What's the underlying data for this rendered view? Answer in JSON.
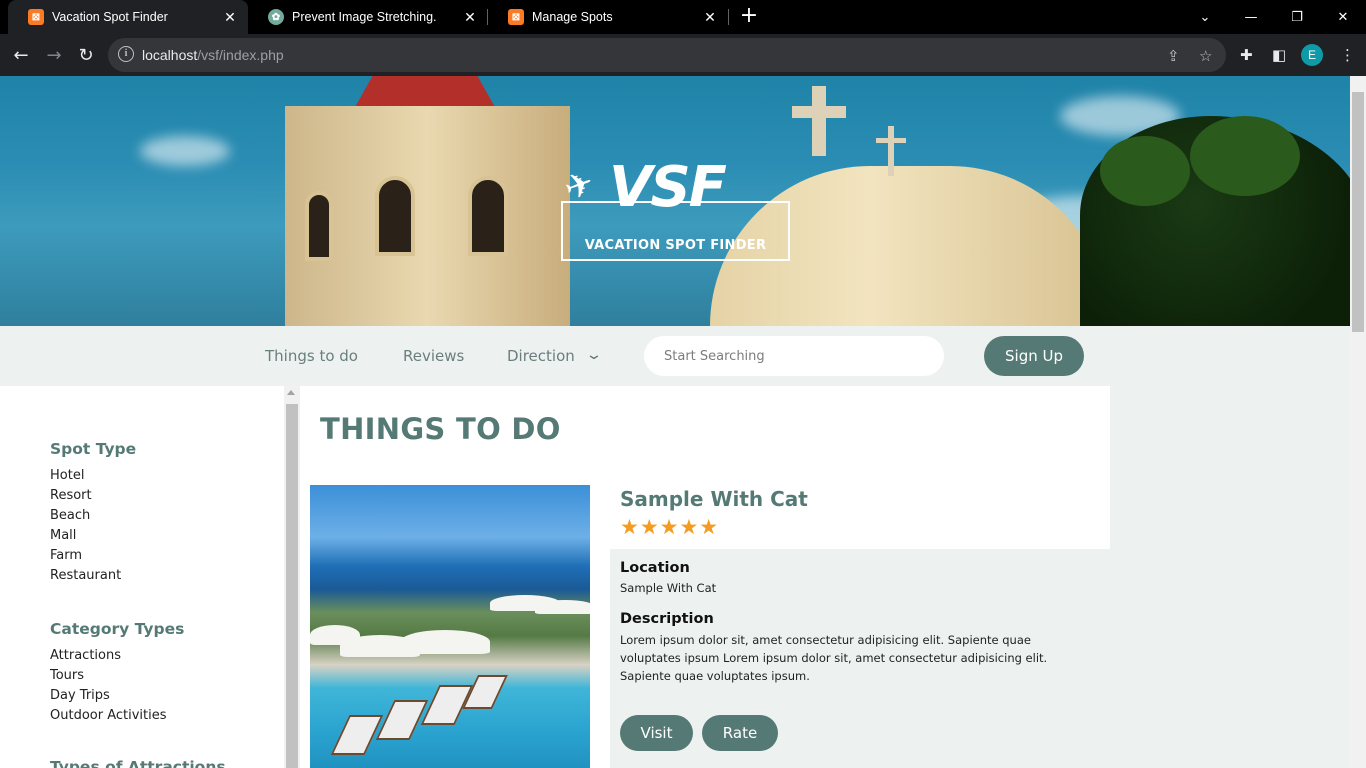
{
  "browser": {
    "tabs": [
      {
        "title": "Vacation Spot Finder",
        "favicon": "xampp-icon",
        "active": true
      },
      {
        "title": "Prevent Image Stretching.",
        "favicon": "chatgpt-icon",
        "active": false
      },
      {
        "title": "Manage Spots",
        "favicon": "xampp-icon",
        "active": false
      }
    ],
    "url_host": "localhost",
    "url_path": "/vsf/index.php",
    "profile_initial": "E"
  },
  "hero": {
    "logo_text": "VSF",
    "logo_tagline": "VACATION SPOT FINDER"
  },
  "nav": {
    "links": [
      "Things to do",
      "Reviews",
      "Direction"
    ],
    "search_placeholder": "Start Searching",
    "signup_label": "Sign Up"
  },
  "sidebar": {
    "sections": [
      {
        "heading": "Spot Type",
        "items": [
          "Hotel",
          "Resort",
          "Beach",
          "Mall",
          "Farm",
          "Restaurant"
        ]
      },
      {
        "heading": "Category Types",
        "items": [
          "Attractions",
          "Tours",
          "Day Trips",
          "Outdoor Activities"
        ]
      },
      {
        "heading": "Types of Attractions",
        "items": []
      }
    ]
  },
  "main": {
    "heading": "THINGS TO DO",
    "spot": {
      "title": "Sample With Cat",
      "rating": 5,
      "rating_stars": "★★★★★",
      "location_label": "Location",
      "location": "Sample With Cat",
      "description_label": "Description",
      "description": "Lorem ipsum dolor sit, amet consectetur adipisicing elit. Sapiente quae voluptates ipsum Lorem ipsum dolor sit, amet consectetur adipisicing elit. Sapiente quae voluptates ipsum.",
      "visit_label": "Visit",
      "rate_label": "Rate"
    }
  },
  "colors": {
    "accent": "#557a75",
    "nav_bg": "#edf2f1",
    "star": "#f39c21"
  }
}
